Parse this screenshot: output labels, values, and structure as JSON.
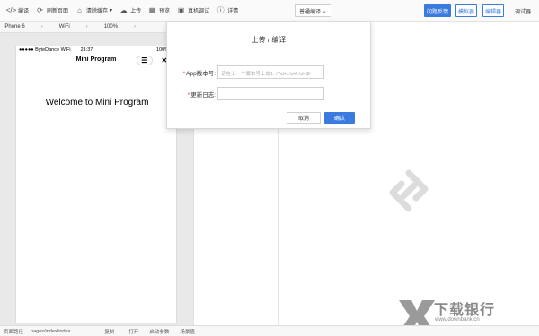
{
  "toolbar": {
    "items": [
      {
        "label": "编译",
        "icon": "code-icon"
      },
      {
        "label": "刷新页面",
        "icon": "refresh-icon"
      },
      {
        "label": "清除缓存",
        "icon": "clear-cache-icon"
      },
      {
        "label": "上传",
        "icon": "upload-cloud-icon"
      },
      {
        "label": "预览",
        "icon": "qrcode-icon"
      },
      {
        "label": "真机调试",
        "icon": "device-debug-icon"
      },
      {
        "label": "详情",
        "icon": "info-icon"
      }
    ],
    "compile_mode": "普通编译",
    "feedback": "问题反馈",
    "simulator": "模拟器",
    "editor": "编辑器",
    "debugger": "调试器"
  },
  "devbar": {
    "device": "iPhone 6",
    "network": "WiFi",
    "zoom": "100%"
  },
  "phone": {
    "carrier": "●●●●● ByteDance WiFi",
    "time": "21:37",
    "battery": "100%",
    "nav_title": "Mini Program",
    "content": "Welcome to Mini Program"
  },
  "dialog": {
    "title": "上传 / 编译",
    "version_label": "App版本号:",
    "version_placeholder": "请在上一个版本号上加1: /^\\d+\\.\\d+\\.\\d+$/",
    "log_label": "更新日志:",
    "cancel": "取消",
    "confirm": "确认"
  },
  "bottombar": {
    "path_label": "页面路径",
    "path": "pages/index/index",
    "copy": "复制",
    "open": "打开",
    "launch_params": "启动参数",
    "scene": "场景值"
  },
  "watermark": {
    "text": "下载银行",
    "url": "www.downbank.cn"
  },
  "colors": {
    "accent": "#3b7be0",
    "required": "#ee3333"
  }
}
